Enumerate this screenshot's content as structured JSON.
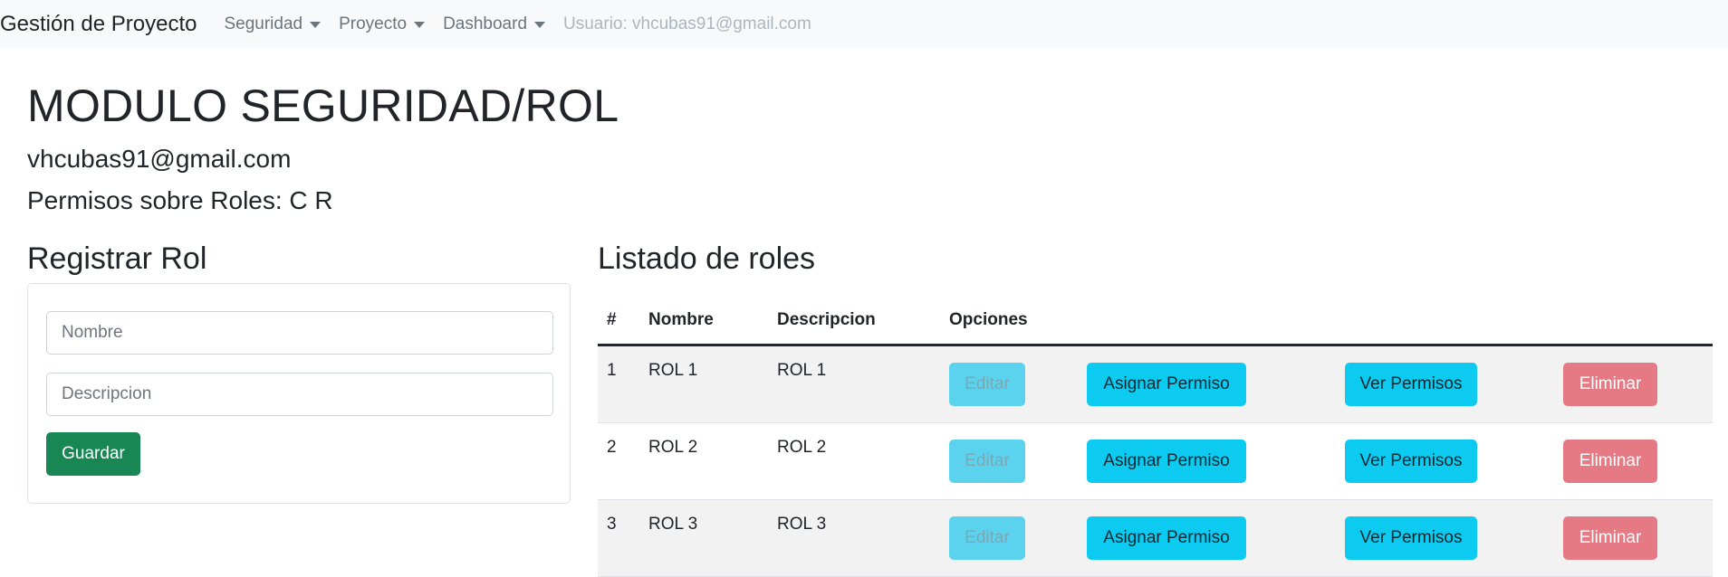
{
  "navbar": {
    "brand": "Gestión de Proyecto",
    "items": [
      {
        "label": "Seguridad"
      },
      {
        "label": "Proyecto"
      },
      {
        "label": "Dashboard"
      }
    ],
    "user": "Usuario: vhcubas91@gmail.com"
  },
  "header": {
    "title": "MODULO SEGURIDAD/ROL",
    "email": "vhcubas91@gmail.com",
    "permissions": "Permisos sobre Roles: C R"
  },
  "form": {
    "title": "Registrar Rol",
    "name_placeholder": "Nombre",
    "description_placeholder": "Descripcion",
    "save_label": "Guardar"
  },
  "list": {
    "title": "Listado de roles",
    "columns": [
      "#",
      "Nombre",
      "Descripcion",
      "Opciones"
    ],
    "rows": [
      {
        "id": "1",
        "name": "ROL 1",
        "description": "ROL 1"
      },
      {
        "id": "2",
        "name": "ROL 2",
        "description": "ROL 2"
      },
      {
        "id": "3",
        "name": "ROL 3",
        "description": "ROL 3"
      }
    ],
    "actions": {
      "edit": "Editar",
      "assign": "Asignar Permiso",
      "view": "Ver Permisos",
      "delete": "Eliminar"
    }
  },
  "colors": {
    "success": "#198754",
    "info": "#0dcaf0",
    "danger": "#dc3545"
  }
}
